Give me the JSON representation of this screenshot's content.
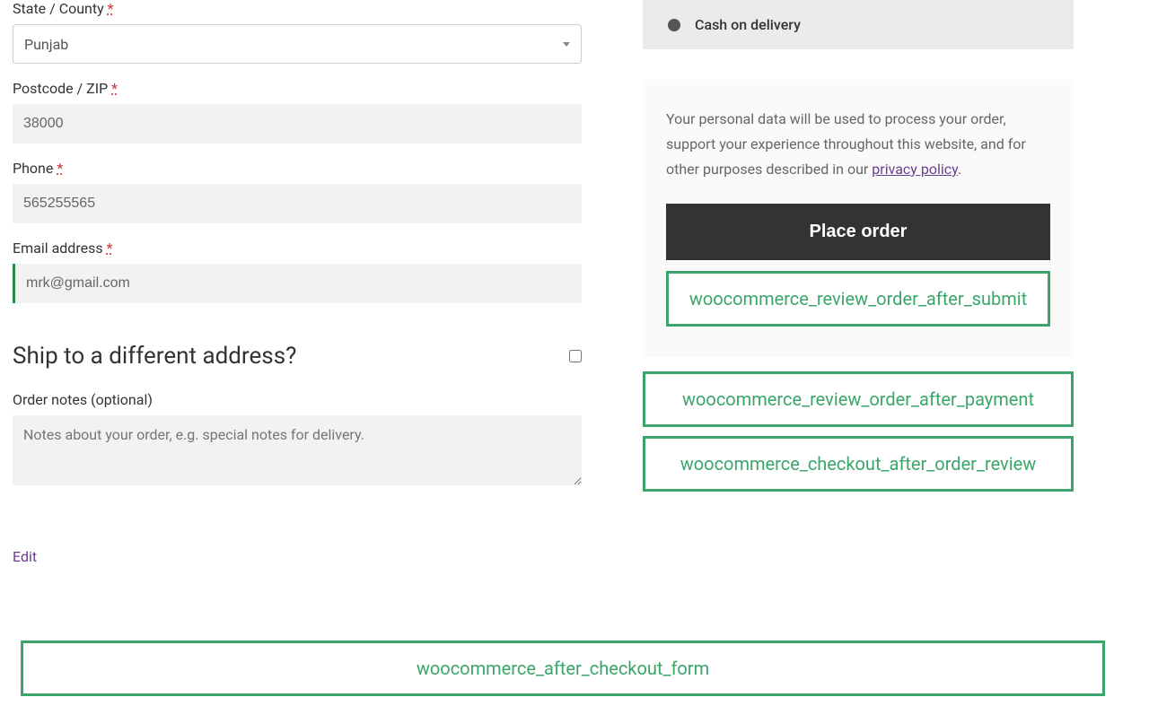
{
  "billing": {
    "state_label": "State / County",
    "state_value": "Punjab",
    "postcode_label": "Postcode / ZIP",
    "postcode_value": "38000",
    "phone_label": "Phone",
    "phone_value": "565255565",
    "email_label": "Email address",
    "email_value": "mrk@gmail.com",
    "required_mark": "*"
  },
  "shipping": {
    "heading": "Ship to a different address?",
    "notes_label": "Order notes (optional)",
    "notes_placeholder": "Notes about your order, e.g. special notes for delivery."
  },
  "edit_link": "Edit",
  "payment": {
    "method_label": "Cash on delivery",
    "privacy_text_pre": "Your personal data will be used to process your order, support your experience throughout this website, and for other purposes described in our ",
    "privacy_link_text": "privacy policy",
    "privacy_text_post": ".",
    "place_order_label": "Place order"
  },
  "hooks": {
    "after_submit": "woocommerce_review_order_after_submit",
    "after_payment": "woocommerce_review_order_after_payment",
    "after_order_review": "woocommerce_checkout_after_order_review",
    "after_checkout_form": "woocommerce_after_checkout_form"
  }
}
